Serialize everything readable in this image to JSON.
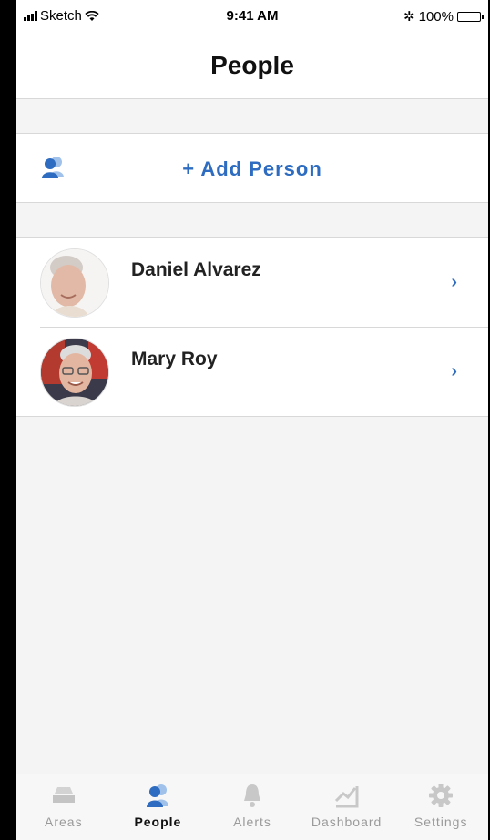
{
  "status": {
    "carrier": "Sketch",
    "time": "9:41 AM",
    "battery": "100%"
  },
  "nav": {
    "title": "People"
  },
  "add": {
    "label": "+ Add Person"
  },
  "people": [
    {
      "name": "Daniel Alvarez"
    },
    {
      "name": "Mary Roy"
    }
  ],
  "tabs": [
    {
      "label": "Areas",
      "icon": "areas-icon",
      "active": false
    },
    {
      "label": "People",
      "icon": "people-icon",
      "active": true
    },
    {
      "label": "Alerts",
      "icon": "bell-icon",
      "active": false
    },
    {
      "label": "Dashboard",
      "icon": "dashboard-icon",
      "active": false
    },
    {
      "label": "Settings",
      "icon": "gear-icon",
      "active": false
    }
  ],
  "colors": {
    "accent": "#2d6cc0",
    "inactive": "#c8c8c8",
    "background": "#f4f4f4"
  }
}
